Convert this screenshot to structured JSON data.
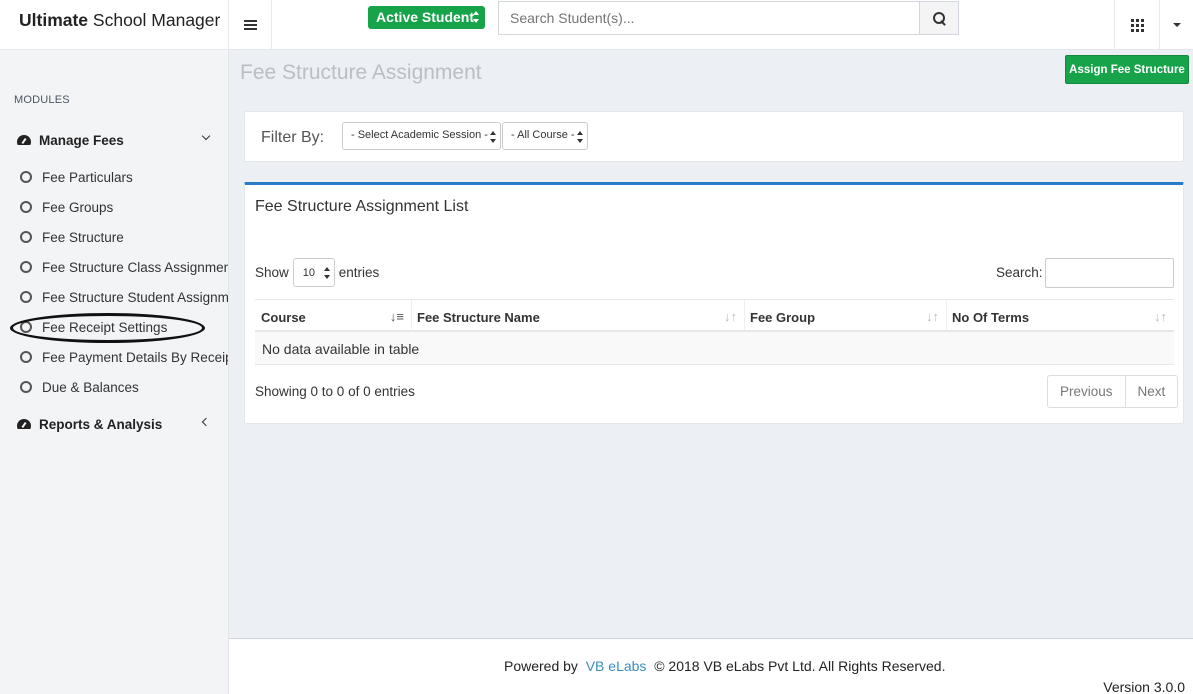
{
  "app": {
    "brand_bold": "Ultimate",
    "brand_rest": " School Manager"
  },
  "header": {
    "student_filter": "Active Student",
    "search_placeholder": "Search Student(s)..."
  },
  "sidebar": {
    "modules_label": "MODULES",
    "manage_fees": {
      "label": "Manage Fees",
      "items": [
        {
          "label": "Fee Particulars"
        },
        {
          "label": "Fee Groups"
        },
        {
          "label": "Fee Structure"
        },
        {
          "label": "Fee Structure Class Assignment"
        },
        {
          "label": "Fee Structure Student Assignment"
        },
        {
          "label": "Fee Receipt Settings"
        },
        {
          "label": "Fee Payment Details By Receipt No"
        },
        {
          "label": "Due & Balances"
        }
      ]
    },
    "reports": {
      "label": "Reports & Analysis"
    }
  },
  "page": {
    "title": "Fee Structure Assignment",
    "assign_button": "Assign Fee Structure"
  },
  "filter": {
    "label": "Filter By:",
    "session_select": "- Select Academic Session -",
    "course_select": "- All Course -"
  },
  "list": {
    "title": "Fee Structure Assignment List",
    "show_label": "Show",
    "page_length": "10",
    "entries_label": "entries",
    "search_label": "Search:",
    "columns": [
      "Course",
      "Fee Structure Name",
      "Fee Group",
      "No Of Terms"
    ],
    "empty_message": "No data available in table",
    "info": "Showing 0 to 0 of 0 entries",
    "prev": "Previous",
    "next": "Next"
  },
  "footer": {
    "powered": "Powered by",
    "company_link": "VB eLabs",
    "copyright": "© 2018 VB eLabs Pvt Ltd. All Rights Reserved.",
    "version": "Version 3.0.0"
  },
  "colors": {
    "accent_green": "#16a34a",
    "accent_blue": "#2b7cc7",
    "link_blue": "#3c8dbc"
  },
  "icons": [
    "hamburger-icon",
    "search-icon",
    "apps-grid-icon",
    "caret-down-icon",
    "dashboard-icon",
    "circle-icon",
    "chevron-icon",
    "sort-icon"
  ]
}
